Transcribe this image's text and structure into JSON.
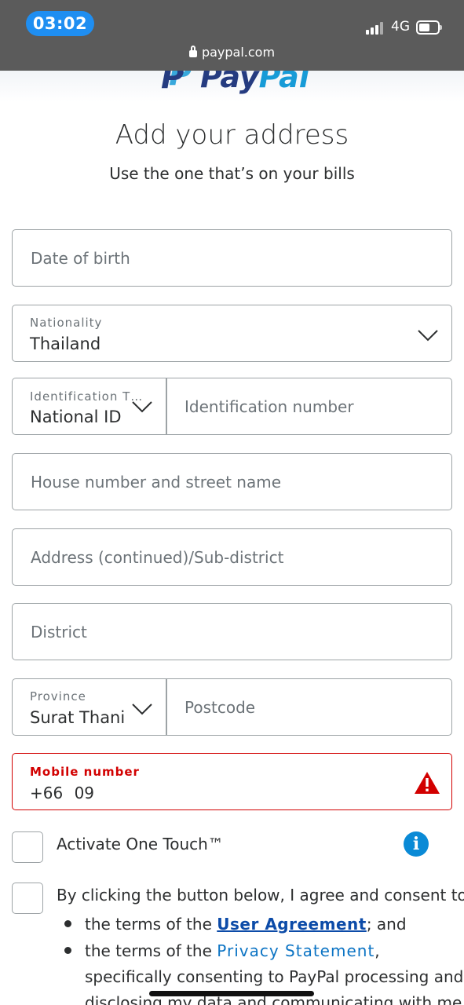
{
  "status_bar": {
    "time": "03:02",
    "network": "4G",
    "url": "paypal.com",
    "icons": [
      "signal-icon",
      "battery-icon",
      "lock-icon"
    ]
  },
  "brand": {
    "logo_text_1": "Pay",
    "logo_text_2": "Pal",
    "primary_color": "#253b80",
    "secondary_color": "#179bd7"
  },
  "page": {
    "title": "Add your address",
    "subtitle": "Use the one that’s on your bills"
  },
  "form": {
    "date_of_birth": {
      "placeholder": "Date of birth"
    },
    "nationality": {
      "label": "Nationality",
      "value": "Thailand"
    },
    "identification_type": {
      "label": "Identification T…",
      "value": "National ID"
    },
    "identification_number": {
      "placeholder": "Identification number"
    },
    "house_street": {
      "placeholder": "House number and street name"
    },
    "address_continued": {
      "placeholder": "Address (continued)/Sub-district"
    },
    "district": {
      "placeholder": "District"
    },
    "province": {
      "label": "Province",
      "value": "Surat Thani"
    },
    "postcode": {
      "placeholder": "Postcode"
    },
    "mobile": {
      "label": "Mobile number",
      "country_code": "+66",
      "value": "09",
      "error_color": "#d20000"
    }
  },
  "one_touch": {
    "label": "Activate One Touch™",
    "icon": "info-icon"
  },
  "consent": {
    "intro": "By clicking the button below, I agree and consent to:",
    "bullet1_pre": "the terms of the ",
    "bullet1_link": "User Agreement",
    "bullet1_post": "; and",
    "bullet2_pre": "the terms of the ",
    "bullet2_link": "Privacy Statement",
    "bullet2_post": ",",
    "line3": "specifically consenting to PayPal processing and",
    "line4": "disclosing my data and communicating with me"
  }
}
